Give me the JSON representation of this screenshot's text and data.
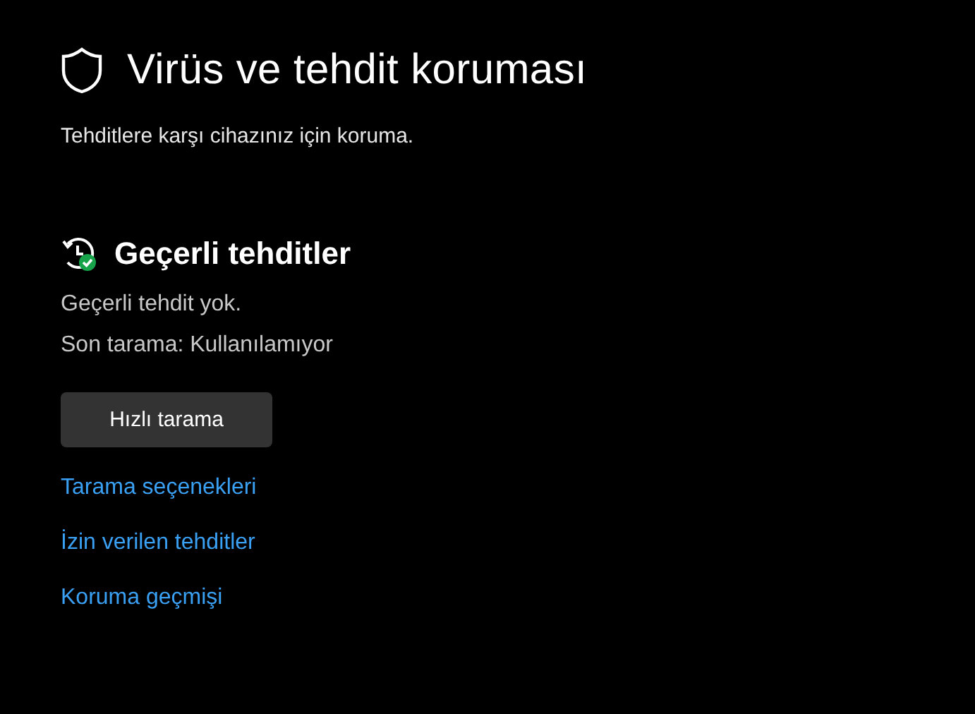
{
  "page": {
    "title": "Virüs ve tehdit koruması",
    "subtitle": "Tehditlere karşı cihazınız için koruma."
  },
  "section": {
    "title": "Geçerli tehditler",
    "lines": [
      "Geçerli tehdit yok.",
      "Son tarama: Kullanılamıyor"
    ],
    "button": "Hızlı tarama",
    "links": [
      "Tarama seçenekleri",
      "İzin verilen tehditler",
      "Koruma geçmişi"
    ]
  }
}
